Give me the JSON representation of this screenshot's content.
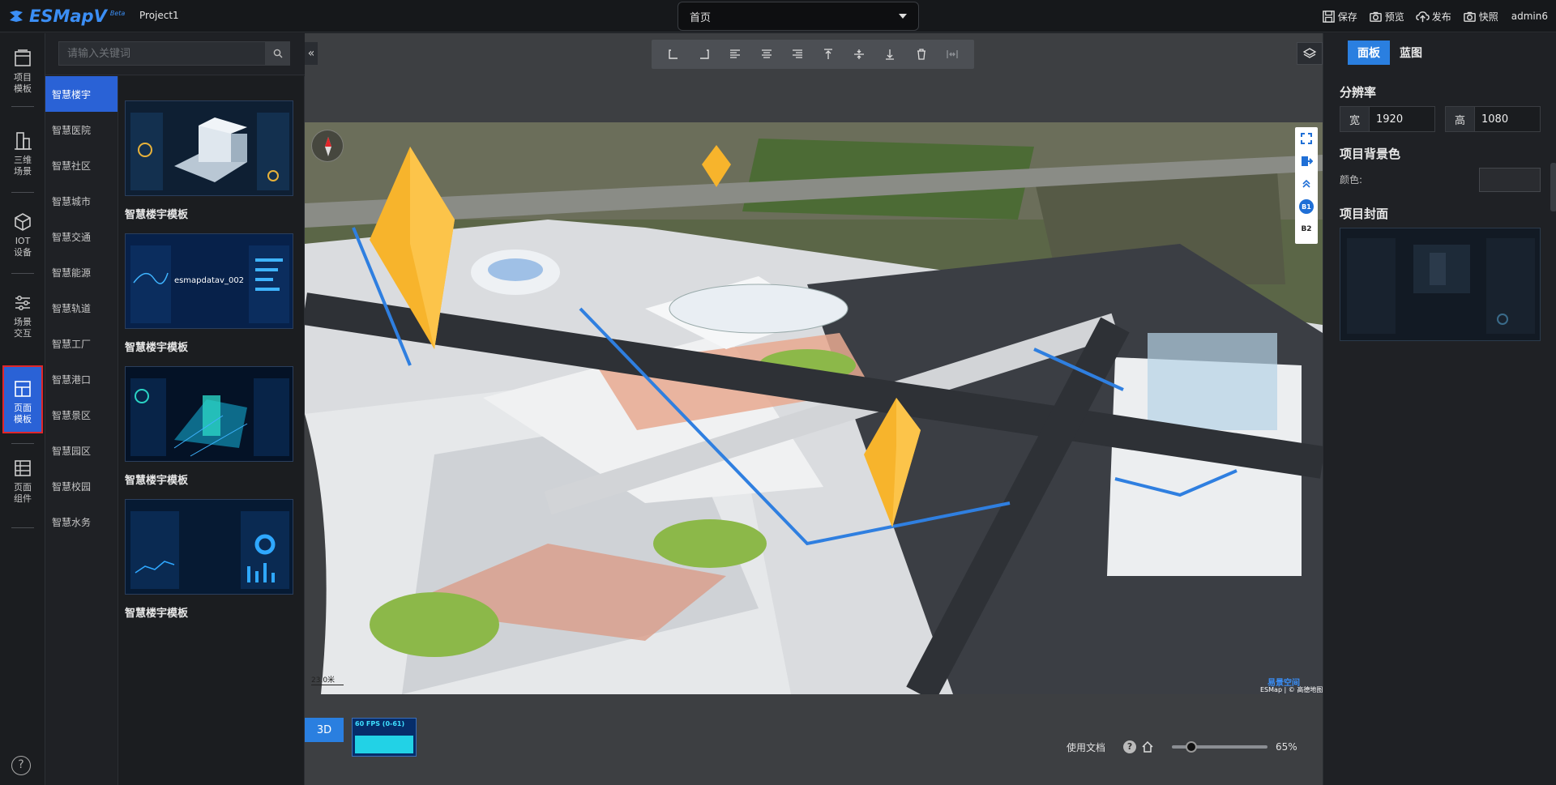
{
  "header": {
    "logo": "ESMapV",
    "logo_badge": "Beta",
    "project": "Project1",
    "page_select": "首页",
    "actions": {
      "save": "保存",
      "preview": "预览",
      "publish": "发布",
      "snapshot": "快照"
    },
    "user": "admin6"
  },
  "leftnav": {
    "items": [
      {
        "label": "项目模板",
        "icon": "template-icon"
      },
      {
        "label": "三维场景",
        "icon": "building-icon"
      },
      {
        "label": "IOT设备",
        "icon": "cube-icon"
      },
      {
        "label": "场景交互",
        "icon": "sliders-icon"
      },
      {
        "label": "页面模板",
        "icon": "layout-icon",
        "active": true
      },
      {
        "label": "页面组件",
        "icon": "grid-icon"
      }
    ],
    "help": "?"
  },
  "search": {
    "placeholder": "请输入关键词"
  },
  "categories": [
    "智慧楼宇",
    "智慧医院",
    "智慧社区",
    "智慧城市",
    "智慧交通",
    "智慧能源",
    "智慧轨道",
    "智慧工厂",
    "智慧港口",
    "智慧景区",
    "智慧园区",
    "智慧校园",
    "智慧水务"
  ],
  "active_category": "智慧楼宇",
  "templates": [
    {
      "name": "智慧楼宇模板",
      "overlay": ""
    },
    {
      "name": "智慧楼宇模板",
      "overlay": "esmapdatav_002"
    },
    {
      "name": "智慧楼宇模板",
      "overlay": ""
    },
    {
      "name": "智慧楼宇模板",
      "overlay": ""
    }
  ],
  "map": {
    "floors": [
      "B1",
      "B2"
    ],
    "scale": "23.0米",
    "attribution": "ESMap | © 高德地图",
    "watermark": "易景空间"
  },
  "bottom": {
    "mode": "3D",
    "fps": "60 FPS (0-61)",
    "docs": "使用文档",
    "zoom": "65%",
    "zoom_fraction": 0.2
  },
  "rightpanel": {
    "tabs": [
      "面板",
      "蓝图"
    ],
    "active_tab": "面板",
    "resolution_title": "分辨率",
    "width_label": "宽",
    "width_value": "1920",
    "height_label": "高",
    "height_value": "1080",
    "bg_title": "项目背景色",
    "color_label": "颜色:",
    "cover_title": "项目封面"
  }
}
